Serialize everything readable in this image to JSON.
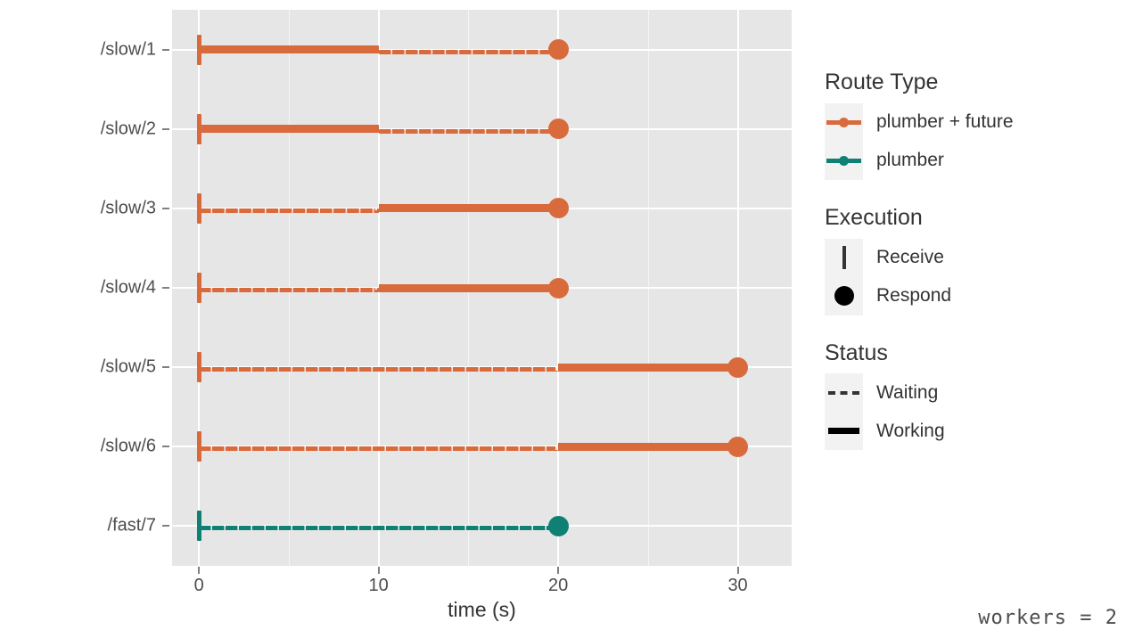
{
  "chart_data": {
    "type": "gantt",
    "title": "",
    "xlabel": "time (s)",
    "ylabel": "",
    "xlim": [
      -1.5,
      33
    ],
    "xticks": [
      0,
      10,
      20,
      30
    ],
    "xticklabels": [
      "0",
      "10",
      "20",
      "30"
    ],
    "categories": [
      "/slow/1",
      "/slow/2",
      "/slow/3",
      "/slow/4",
      "/slow/5",
      "/slow/6",
      "/fast/7"
    ],
    "grid": true,
    "legend_position": "right",
    "colors": {
      "plumber_future": "#D96A3C",
      "plumber": "#0E8174",
      "panel_background": "#E6E6E6",
      "gridline": "#FFFFFF",
      "legend_key_background": "#F2F2F2",
      "text": "#333333"
    },
    "rows": [
      {
        "label": "/slow/1",
        "route_type": "plumber + future",
        "color": "#D96A3C",
        "receive": 0,
        "respond": 20,
        "segments": [
          {
            "status": "Working",
            "start": 0,
            "end": 10
          },
          {
            "status": "Waiting",
            "start": 10,
            "end": 20
          }
        ]
      },
      {
        "label": "/slow/2",
        "route_type": "plumber + future",
        "color": "#D96A3C",
        "receive": 0,
        "respond": 20,
        "segments": [
          {
            "status": "Working",
            "start": 0,
            "end": 10
          },
          {
            "status": "Waiting",
            "start": 10,
            "end": 20
          }
        ]
      },
      {
        "label": "/slow/3",
        "route_type": "plumber + future",
        "color": "#D96A3C",
        "receive": 0,
        "respond": 20,
        "segments": [
          {
            "status": "Waiting",
            "start": 0,
            "end": 10
          },
          {
            "status": "Working",
            "start": 10,
            "end": 20
          }
        ]
      },
      {
        "label": "/slow/4",
        "route_type": "plumber + future",
        "color": "#D96A3C",
        "receive": 0,
        "respond": 20,
        "segments": [
          {
            "status": "Waiting",
            "start": 0,
            "end": 10
          },
          {
            "status": "Working",
            "start": 10,
            "end": 20
          }
        ]
      },
      {
        "label": "/slow/5",
        "route_type": "plumber + future",
        "color": "#D96A3C",
        "receive": 0,
        "respond": 30,
        "segments": [
          {
            "status": "Waiting",
            "start": 0,
            "end": 20
          },
          {
            "status": "Working",
            "start": 20,
            "end": 30
          }
        ]
      },
      {
        "label": "/slow/6",
        "route_type": "plumber + future",
        "color": "#D96A3C",
        "receive": 0,
        "respond": 30,
        "segments": [
          {
            "status": "Waiting",
            "start": 0,
            "end": 20
          },
          {
            "status": "Working",
            "start": 20,
            "end": 30
          }
        ]
      },
      {
        "label": "/fast/7",
        "route_type": "plumber",
        "color": "#0E8174",
        "receive": 0,
        "respond": 20,
        "segments": [
          {
            "status": "Waiting",
            "start": 0,
            "end": 20
          }
        ]
      }
    ]
  },
  "axis": {
    "x_title": "time (s)"
  },
  "legends": [
    {
      "title": "Route Type",
      "kind": "line",
      "items": [
        {
          "label": "plumber + future",
          "color": "#D96A3C"
        },
        {
          "label": "plumber",
          "color": "#0E8174"
        }
      ]
    },
    {
      "title": "Execution",
      "kind": "shape",
      "items": [
        {
          "label": "Receive",
          "shape": "bar"
        },
        {
          "label": "Respond",
          "shape": "circle"
        }
      ]
    },
    {
      "title": "Status",
      "kind": "linetype",
      "items": [
        {
          "label": "Waiting",
          "shape": "dashed"
        },
        {
          "label": "Working",
          "shape": "solid"
        }
      ]
    }
  ],
  "caption": {
    "workers": "workers = 2"
  }
}
